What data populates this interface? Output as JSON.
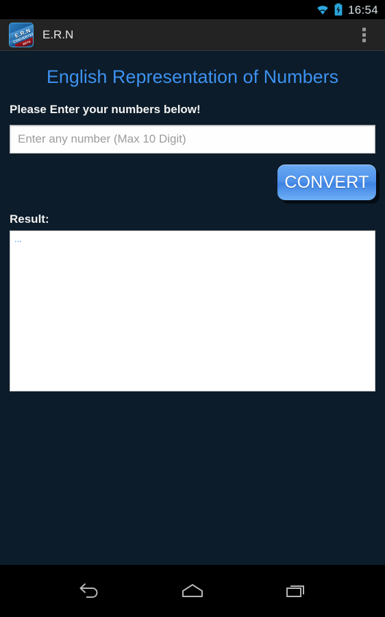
{
  "status_bar": {
    "time": "16:54",
    "icons": [
      "wifi-icon",
      "battery-charging-icon"
    ]
  },
  "action_bar": {
    "app_icon_label": "E.R.N",
    "app_icon_sub_label": "CONVERTER",
    "app_icon_ribbon": "BETA",
    "title": "E.R.N",
    "overflow_icon": "overflow-menu-icon"
  },
  "main": {
    "page_title": "English Representation of Numbers",
    "prompt_label": "Please Enter your numbers below!",
    "input": {
      "placeholder": "Enter any number (Max 10 Digit)",
      "value": ""
    },
    "convert_label": "CONVERT",
    "result_label": "Result:",
    "result_text": "..."
  },
  "nav_bar": {
    "back_label": "back-icon",
    "home_label": "home-icon",
    "recents_label": "recents-icon"
  },
  "colors": {
    "background": "#0c1c2a",
    "action_bar": "#232323",
    "accent_blue": "#3d91f0",
    "button_blue": "#4f93ec",
    "status_bar": "#000000"
  }
}
